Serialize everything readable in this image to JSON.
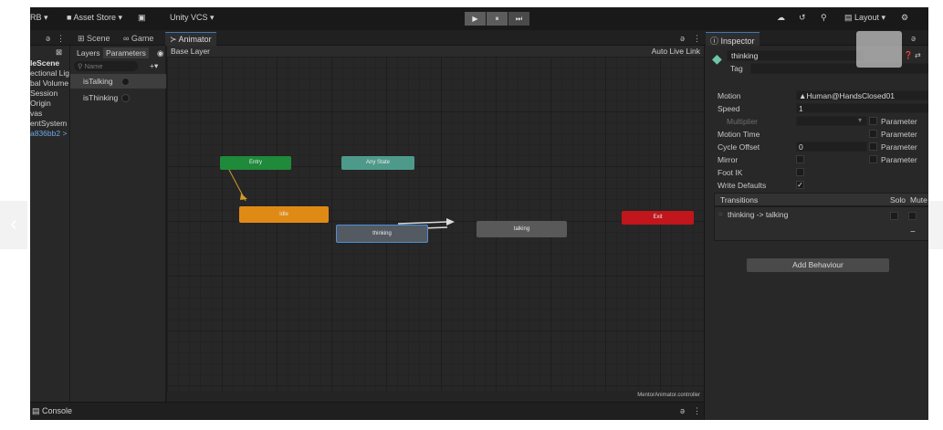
{
  "toolbar": {
    "account": "RB ▾",
    "asset_store": "Asset Store ▾",
    "vcs": "Unity VCS ▾",
    "play_glyph": "▶",
    "pause_glyph": "⏸",
    "step_glyph": "⏭",
    "layout": "Layout ▾"
  },
  "tabs": {
    "scene": "Scene",
    "game": "Game",
    "animator": "Animator",
    "inspector": "Inspector",
    "dots": "⋮"
  },
  "hierarchy": {
    "items": [
      "leScene",
      "ectional Ligh",
      "bal Volume",
      "Session",
      "Origin",
      "vas",
      "entSystem",
      "a836bb2 >"
    ]
  },
  "params_panel": {
    "layers_tab": "Layers",
    "parameters_tab": "Parameters",
    "search_placeholder": "Name",
    "add_glyph": "+▾",
    "params": [
      {
        "name": "isTalking"
      },
      {
        "name": "isThinking"
      }
    ]
  },
  "graph": {
    "breadcrumb": "Base Layer",
    "auto_live_link": "Auto Live Link",
    "footer_path": "MentorAnimator.controller",
    "states": {
      "entry": "Entry",
      "any_state": "Any State",
      "idle": "Idle",
      "thinking": "thinking",
      "talking": "talking",
      "exit": "Exit"
    }
  },
  "console": {
    "label": "Console"
  },
  "inspector": {
    "state_name": "thinking",
    "tag_label": "Tag",
    "rows": {
      "motion_label": "Motion",
      "motion_value": "Human@HandsClosed01",
      "speed_label": "Speed",
      "speed_value": "1",
      "multiplier_label": "Multiplier",
      "motion_time_label": "Motion Time",
      "cycle_offset_label": "Cycle Offset",
      "cycle_offset_value": "0",
      "mirror_label": "Mirror",
      "foot_ik_label": "Foot IK",
      "write_defaults_label": "Write Defaults",
      "parameter_label": "Parameter"
    },
    "transitions": {
      "header": "Transitions",
      "solo": "Solo",
      "mute": "Mute",
      "items": [
        "thinking -> talking"
      ]
    },
    "add_behaviour": "Add Behaviour",
    "write_defaults_checked": true
  }
}
